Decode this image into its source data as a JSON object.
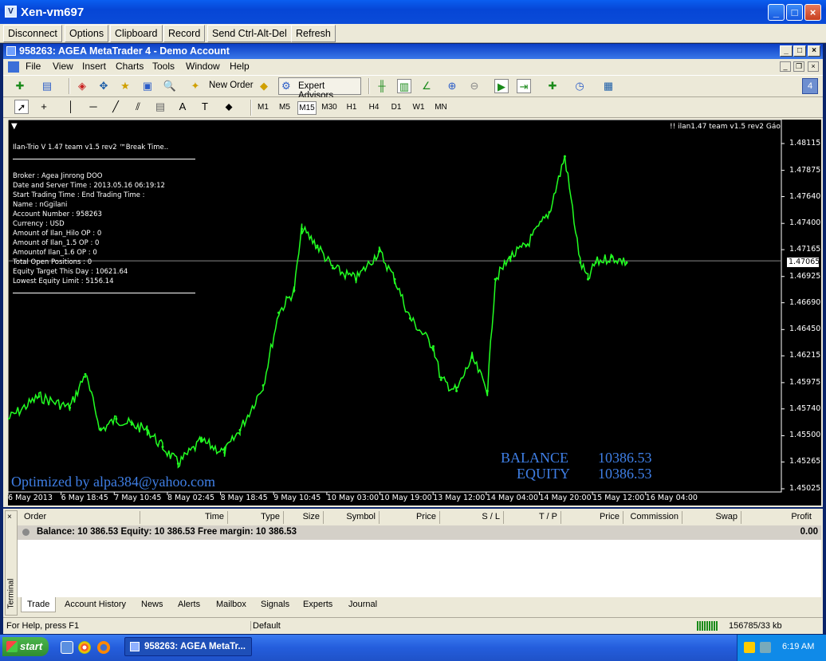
{
  "vnc": {
    "title": "Xen-vm697",
    "toolbar": [
      "Disconnect",
      "Options",
      "Clipboard",
      "Record",
      "Send Ctrl-Alt-Del",
      "Refresh"
    ]
  },
  "mt4": {
    "title": "958263: AGEA MetaTrader 4 - Demo Account",
    "menu": [
      "File",
      "View",
      "Insert",
      "Charts",
      "Tools",
      "Window",
      "Help"
    ],
    "toolbar": {
      "new_order": "New Order",
      "expert_advisors": "Expert Advisors",
      "counter": "4"
    },
    "periods": [
      "M1",
      "M5",
      "M15",
      "M30",
      "H1",
      "H4",
      "D1",
      "W1",
      "MN"
    ],
    "active_period": "M15"
  },
  "chart": {
    "ea_label": "!! ilan1.47 team v1.5 rev2 Gáo",
    "info": [
      "Ilan-Trio V 1.47 team v1.5 rev2 ™Break Time..",
      "Broker :  Agea Jinrong DOO",
      "Date and Server Time  :  2013.05.16 06:19:12",
      "Start Trading Time  :                  End Trading Time  :",
      "Name  :  nGgilani",
      "Account Number  :  958263",
      "Currency  :  USD",
      "Amount of Ilan_Hilo OP  :  0",
      "Amount of Ilan_1.5 OP  :  0",
      "Amountof Ilan_1.6 OP  :  0",
      "Total Open Positions  :  0",
      "Equity Target This Day  :  10621.64",
      "Lowest Equity Limit  :  5156.14"
    ],
    "balance_label": "BALANCE",
    "balance_value": "10386.53",
    "equity_label": "EQUITY",
    "equity_value": "10386.53",
    "optimized": "Optimized by  alpa384@yahoo.com",
    "current_price": "1.47065"
  },
  "chart_data": {
    "type": "line",
    "title": "",
    "ylabels": [
      "1.48115",
      "1.47875",
      "1.47640",
      "1.47400",
      "1.47165",
      "1.46925",
      "1.46690",
      "1.46450",
      "1.46215",
      "1.45975",
      "1.45740",
      "1.45500",
      "1.45265",
      "1.45025"
    ],
    "xlabels": [
      "6 May 2013",
      "6 May 18:45",
      "7 May 10:45",
      "8 May 02:45",
      "8 May 18:45",
      "9 May 10:45",
      "10 May 03:00",
      "10 May 19:00",
      "13 May 12:00",
      "14 May 04:00",
      "14 May 20:00",
      "15 May 12:00",
      "16 May 04:00"
    ],
    "ylim": [
      1.45025,
      1.48115
    ],
    "x": [
      0,
      0.04,
      0.08,
      0.1,
      0.12,
      0.14,
      0.16,
      0.18,
      0.2,
      0.22,
      0.25,
      0.28,
      0.3,
      0.33,
      0.35,
      0.37,
      0.38,
      0.4,
      0.42,
      0.45,
      0.48,
      0.5,
      0.52,
      0.55,
      0.56,
      0.58,
      0.6,
      0.62,
      0.63,
      0.65,
      0.67,
      0.7,
      0.72,
      0.74,
      0.75,
      0.76,
      0.78,
      0.8
    ],
    "y": [
      1.4565,
      1.4585,
      1.4575,
      1.4605,
      1.4555,
      1.4565,
      1.456,
      1.4555,
      1.454,
      1.4525,
      1.4545,
      1.4535,
      1.4555,
      1.4595,
      1.466,
      1.468,
      1.4735,
      1.472,
      1.47,
      1.469,
      1.4715,
      1.469,
      1.4655,
      1.463,
      1.46,
      1.459,
      1.462,
      1.459,
      1.469,
      1.471,
      1.472,
      1.475,
      1.48,
      1.4705,
      1.469,
      1.4705,
      1.471,
      1.4705
    ]
  },
  "terminal": {
    "columns": [
      "Order",
      "Time",
      "Type",
      "Size",
      "Symbol",
      "Price",
      "S / L",
      "T / P",
      "Price",
      "Commission",
      "Swap",
      "Profit"
    ],
    "balance_line": "Balance: 10 386.53  Equity: 10 386.53  Free margin: 10 386.53",
    "profit": "0.00",
    "side_label": "Terminal",
    "tabs": [
      "Trade",
      "Account History",
      "News",
      "Alerts",
      "Mailbox",
      "Signals",
      "Experts",
      "Journal"
    ],
    "active_tab": "Trade"
  },
  "status": {
    "help": "For Help, press F1",
    "profile": "Default",
    "traffic": "156785/33 kb"
  },
  "taskbar": {
    "start": "start",
    "task": "958263: AGEA MetaTr...",
    "clock": "6:19 AM"
  }
}
